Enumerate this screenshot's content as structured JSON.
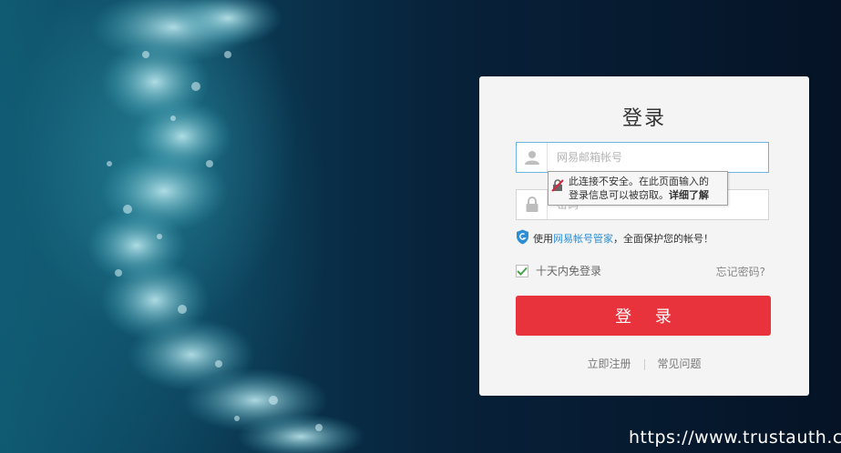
{
  "login": {
    "title": "登录",
    "username_placeholder": "网易邮箱帐号",
    "password_placeholder": "密码",
    "tooltip_line1": "此连接不安全。在此页面输入的",
    "tooltip_line2": "登录信息可以被窃取。",
    "tooltip_link": "详细了解",
    "protect_prefix": "使用",
    "protect_link": "网易帐号管家",
    "protect_suffix": "，全面保护您的帐号！",
    "remember_label": "十天内免登录",
    "remember_checked": true,
    "forgot_label": "忘记密码?",
    "login_button": "登 录",
    "register_link": "立即注册",
    "faq_link": "常见问题"
  },
  "watermark": "https://www.trustauth.cn",
  "colors": {
    "button": "#e8323c",
    "link": "#2c8ed6",
    "check": "#4aa34a"
  },
  "icons": [
    "user-icon",
    "lock-icon",
    "insecure-lock-icon",
    "shield-icon",
    "checkmark-icon"
  ]
}
